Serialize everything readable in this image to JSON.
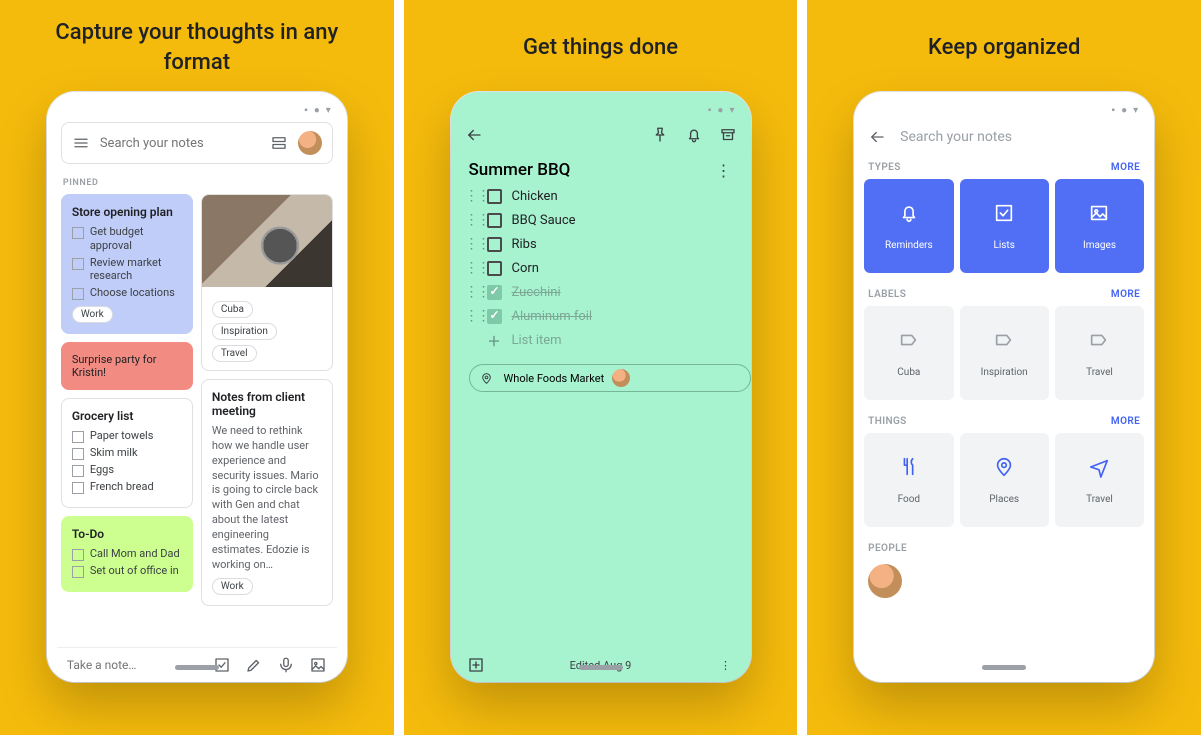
{
  "panels": [
    {
      "headline": "Capture your thoughts in any format"
    },
    {
      "headline": "Get things done"
    },
    {
      "headline": "Keep organized"
    }
  ],
  "phone1": {
    "search_placeholder": "Search your notes",
    "pinned_label": "PINNED",
    "blue": {
      "title": "Store opening plan",
      "items": [
        "Get budget approval",
        "Review market research",
        "Choose locations"
      ],
      "chip": "Work"
    },
    "red_text": "Surprise party for Kristin!",
    "grocery": {
      "title": "Grocery list",
      "items": [
        "Paper towels",
        "Skim milk",
        "Eggs",
        "French bread"
      ]
    },
    "todo": {
      "title": "To-Do",
      "items": [
        "Call Mom and Dad",
        "Set out of office in"
      ]
    },
    "imgcard_chips": [
      "Cuba",
      "Inspiration",
      "Travel"
    ],
    "notes": {
      "title": "Notes from client meeting",
      "body": "We need to rethink how we handle user experience and security issues. Mario is going to circle back with Gen and chat about the latest engineering estimates. Edozie is working on…",
      "chip": "Work"
    },
    "take_note": "Take a note…"
  },
  "phone2": {
    "title": "Summer BBQ",
    "items": [
      {
        "text": "Chicken",
        "done": false
      },
      {
        "text": "BBQ Sauce",
        "done": false
      },
      {
        "text": "Ribs",
        "done": false
      },
      {
        "text": "Corn",
        "done": false
      },
      {
        "text": "Zucchini",
        "done": true
      },
      {
        "text": "Aluminum foil",
        "done": true
      }
    ],
    "add_item": "List item",
    "location": "Whole Foods Market",
    "edited": "Edited Aug 9"
  },
  "phone3": {
    "search_placeholder": "Search your notes",
    "sections": {
      "types": {
        "label": "TYPES",
        "more": "MORE",
        "tiles": [
          "Reminders",
          "Lists",
          "Images"
        ]
      },
      "labels": {
        "label": "LABELS",
        "more": "MORE",
        "tiles": [
          "Cuba",
          "Inspiration",
          "Travel"
        ]
      },
      "things": {
        "label": "THINGS",
        "more": "MORE",
        "tiles": [
          "Food",
          "Places",
          "Travel"
        ]
      },
      "people": {
        "label": "PEOPLE"
      }
    }
  }
}
